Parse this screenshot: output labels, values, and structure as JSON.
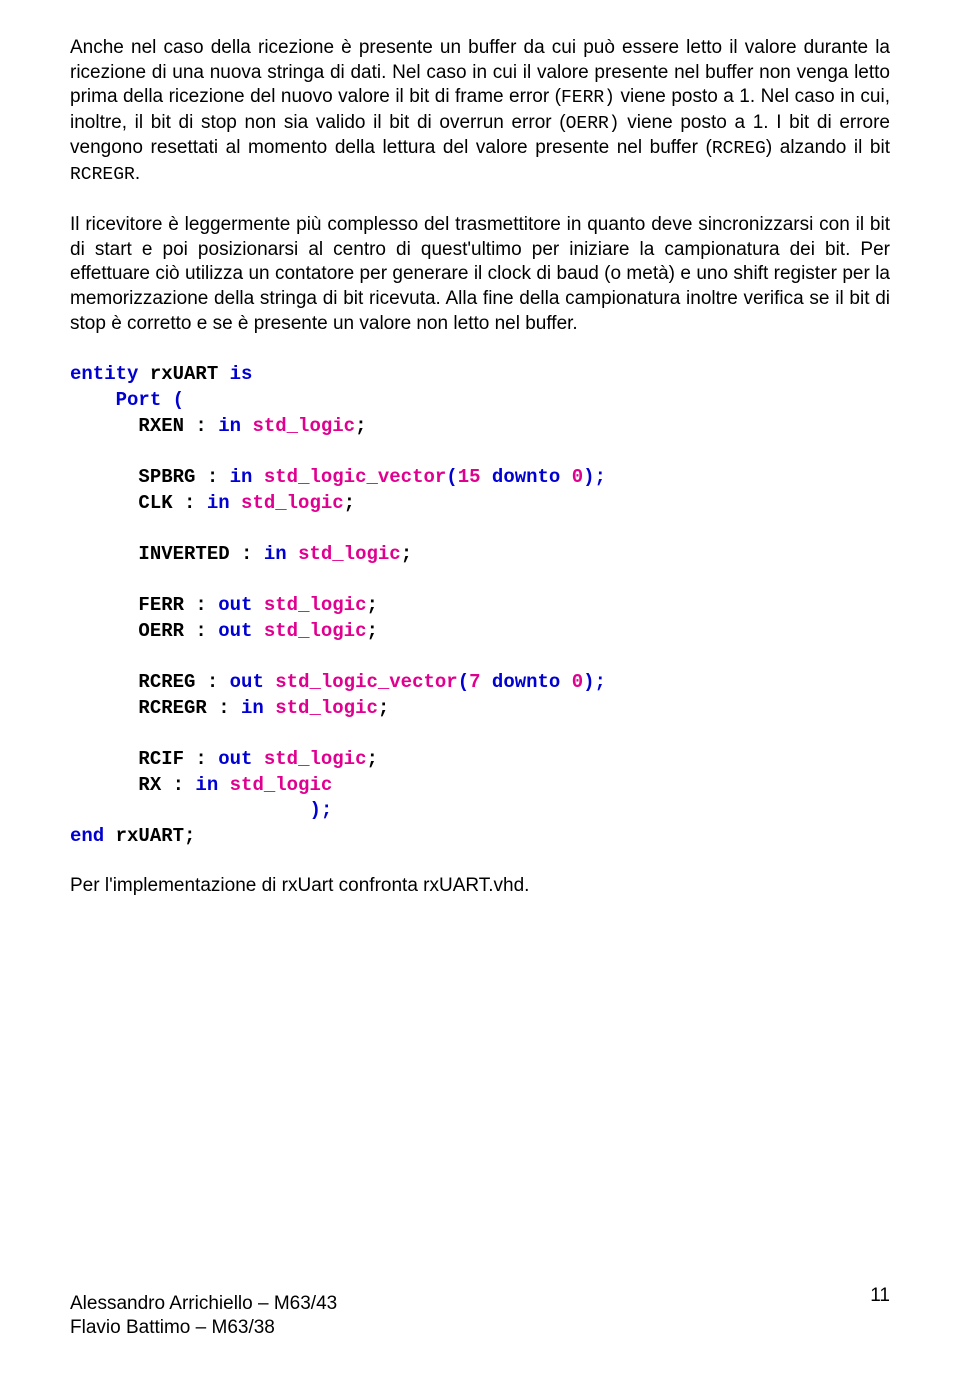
{
  "para1_parts": [
    {
      "t": "Anche nel caso della ricezione è presente un buffer da cui può essere letto il valore durante la ricezione di una nuova stringa di dati. Nel caso in cui il valore presente nel buffer non venga letto prima della ricezione del nuovo valore il bit di frame error (",
      "c": false
    },
    {
      "t": "FERR)",
      "c": true
    },
    {
      "t": " viene posto a 1. Nel caso in cui, inoltre, il bit di stop non sia valido il bit di overrun error (",
      "c": false
    },
    {
      "t": "OERR)",
      "c": true
    },
    {
      "t": "  viene posto a 1. I bit di errore vengono resettati al momento della lettura del valore presente nel buffer (",
      "c": false
    },
    {
      "t": "RCREG",
      "c": true
    },
    {
      "t": ") alzando il bit ",
      "c": false
    },
    {
      "t": "RCREGR",
      "c": true
    },
    {
      "t": ".",
      "c": false
    }
  ],
  "para2": "Il ricevitore è leggermente più complesso del trasmettitore in quanto deve sincronizzarsi con il bit di start e poi posizionarsi al centro di quest'ultimo per iniziare la campionatura dei bit. Per effettuare ciò utilizza un contatore per generare il clock di baud (o metà) e uno shift register per la memorizzazione della stringa di bit ricevuta. Alla fine della campionatura inoltre verifica se il bit di stop è corretto e se è presente un valore non letto nel buffer.",
  "code_lines": [
    [
      {
        "t": "entity",
        "k": "kw"
      },
      {
        "t": " rxUART ",
        "k": "id"
      },
      {
        "t": "is",
        "k": "kw"
      }
    ],
    [
      {
        "t": "    ",
        "k": "id"
      },
      {
        "t": "Port (",
        "k": "kw"
      }
    ],
    [
      {
        "t": "      RXEN : ",
        "k": "id"
      },
      {
        "t": "in",
        "k": "kw"
      },
      {
        "t": " ",
        "k": "id"
      },
      {
        "t": "std_logic",
        "k": "ty"
      },
      {
        "t": ";",
        "k": "id"
      }
    ],
    [
      {
        "t": "",
        "k": "id"
      }
    ],
    [
      {
        "t": "      SPBRG : ",
        "k": "id"
      },
      {
        "t": "in",
        "k": "kw"
      },
      {
        "t": " ",
        "k": "id"
      },
      {
        "t": "std_logic_vector",
        "k": "ty"
      },
      {
        "t": "(",
        "k": "kw"
      },
      {
        "t": "15",
        "k": "num"
      },
      {
        "t": " ",
        "k": "id"
      },
      {
        "t": "downto",
        "k": "kw"
      },
      {
        "t": " ",
        "k": "id"
      },
      {
        "t": "0",
        "k": "num"
      },
      {
        "t": ");",
        "k": "kw"
      }
    ],
    [
      {
        "t": "      CLK : ",
        "k": "id"
      },
      {
        "t": "in",
        "k": "kw"
      },
      {
        "t": " ",
        "k": "id"
      },
      {
        "t": "std_logic",
        "k": "ty"
      },
      {
        "t": ";",
        "k": "id"
      }
    ],
    [
      {
        "t": "",
        "k": "id"
      }
    ],
    [
      {
        "t": "      INVERTED : ",
        "k": "id"
      },
      {
        "t": "in",
        "k": "kw"
      },
      {
        "t": " ",
        "k": "id"
      },
      {
        "t": "std_logic",
        "k": "ty"
      },
      {
        "t": ";",
        "k": "id"
      }
    ],
    [
      {
        "t": "",
        "k": "id"
      }
    ],
    [
      {
        "t": "      FERR : ",
        "k": "id"
      },
      {
        "t": "out",
        "k": "kw"
      },
      {
        "t": " ",
        "k": "id"
      },
      {
        "t": "std_logic",
        "k": "ty"
      },
      {
        "t": ";",
        "k": "id"
      }
    ],
    [
      {
        "t": "      OERR : ",
        "k": "id"
      },
      {
        "t": "out",
        "k": "kw"
      },
      {
        "t": " ",
        "k": "id"
      },
      {
        "t": "std_logic",
        "k": "ty"
      },
      {
        "t": ";",
        "k": "id"
      }
    ],
    [
      {
        "t": "",
        "k": "id"
      }
    ],
    [
      {
        "t": "      RCREG : ",
        "k": "id"
      },
      {
        "t": "out",
        "k": "kw"
      },
      {
        "t": " ",
        "k": "id"
      },
      {
        "t": "std_logic_vector",
        "k": "ty"
      },
      {
        "t": "(",
        "k": "kw"
      },
      {
        "t": "7",
        "k": "num"
      },
      {
        "t": " ",
        "k": "id"
      },
      {
        "t": "downto",
        "k": "kw"
      },
      {
        "t": " ",
        "k": "id"
      },
      {
        "t": "0",
        "k": "num"
      },
      {
        "t": ");",
        "k": "kw"
      }
    ],
    [
      {
        "t": "      RCREGR : ",
        "k": "id"
      },
      {
        "t": "in",
        "k": "kw"
      },
      {
        "t": " ",
        "k": "id"
      },
      {
        "t": "std_logic",
        "k": "ty"
      },
      {
        "t": ";",
        "k": "id"
      }
    ],
    [
      {
        "t": "",
        "k": "id"
      }
    ],
    [
      {
        "t": "      RCIF : ",
        "k": "id"
      },
      {
        "t": "out",
        "k": "kw"
      },
      {
        "t": " ",
        "k": "id"
      },
      {
        "t": "std_logic",
        "k": "ty"
      },
      {
        "t": ";",
        "k": "id"
      }
    ],
    [
      {
        "t": "      RX : ",
        "k": "id"
      },
      {
        "t": "in",
        "k": "kw"
      },
      {
        "t": " ",
        "k": "id"
      },
      {
        "t": "std_logic",
        "k": "ty"
      }
    ],
    [
      {
        "t": "                     ",
        "k": "id"
      },
      {
        "t": ");",
        "k": "kw"
      }
    ],
    [
      {
        "t": "end",
        "k": "kw"
      },
      {
        "t": " rxUART;",
        "k": "id"
      }
    ]
  ],
  "after_code": "Per l'implementazione di rxUart confronta rxUART.vhd.",
  "footer_line1": "Alessandro Arrichiello – M63/43",
  "footer_line2": "Flavio Battimo – M63/38",
  "page_num": "11"
}
